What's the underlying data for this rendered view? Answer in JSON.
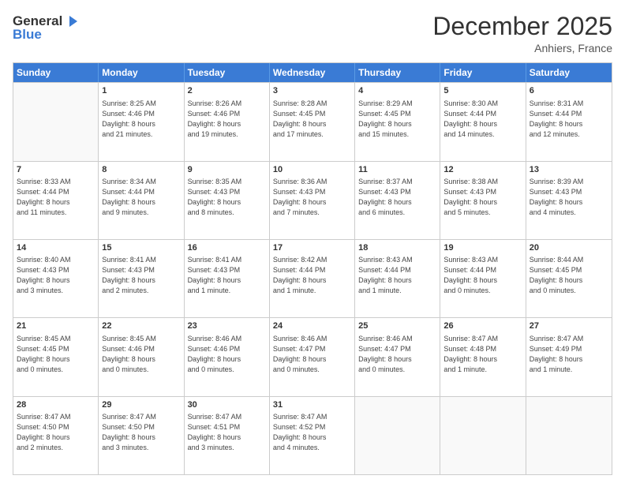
{
  "header": {
    "logo_general": "General",
    "logo_blue": "Blue",
    "month_title": "December 2025",
    "location": "Anhiers, France"
  },
  "day_headers": [
    "Sunday",
    "Monday",
    "Tuesday",
    "Wednesday",
    "Thursday",
    "Friday",
    "Saturday"
  ],
  "weeks": [
    [
      {
        "date": "",
        "info": ""
      },
      {
        "date": "1",
        "info": "Sunrise: 8:25 AM\nSunset: 4:46 PM\nDaylight: 8 hours\nand 21 minutes."
      },
      {
        "date": "2",
        "info": "Sunrise: 8:26 AM\nSunset: 4:46 PM\nDaylight: 8 hours\nand 19 minutes."
      },
      {
        "date": "3",
        "info": "Sunrise: 8:28 AM\nSunset: 4:45 PM\nDaylight: 8 hours\nand 17 minutes."
      },
      {
        "date": "4",
        "info": "Sunrise: 8:29 AM\nSunset: 4:45 PM\nDaylight: 8 hours\nand 15 minutes."
      },
      {
        "date": "5",
        "info": "Sunrise: 8:30 AM\nSunset: 4:44 PM\nDaylight: 8 hours\nand 14 minutes."
      },
      {
        "date": "6",
        "info": "Sunrise: 8:31 AM\nSunset: 4:44 PM\nDaylight: 8 hours\nand 12 minutes."
      }
    ],
    [
      {
        "date": "7",
        "info": "Sunrise: 8:33 AM\nSunset: 4:44 PM\nDaylight: 8 hours\nand 11 minutes."
      },
      {
        "date": "8",
        "info": "Sunrise: 8:34 AM\nSunset: 4:44 PM\nDaylight: 8 hours\nand 9 minutes."
      },
      {
        "date": "9",
        "info": "Sunrise: 8:35 AM\nSunset: 4:43 PM\nDaylight: 8 hours\nand 8 minutes."
      },
      {
        "date": "10",
        "info": "Sunrise: 8:36 AM\nSunset: 4:43 PM\nDaylight: 8 hours\nand 7 minutes."
      },
      {
        "date": "11",
        "info": "Sunrise: 8:37 AM\nSunset: 4:43 PM\nDaylight: 8 hours\nand 6 minutes."
      },
      {
        "date": "12",
        "info": "Sunrise: 8:38 AM\nSunset: 4:43 PM\nDaylight: 8 hours\nand 5 minutes."
      },
      {
        "date": "13",
        "info": "Sunrise: 8:39 AM\nSunset: 4:43 PM\nDaylight: 8 hours\nand 4 minutes."
      }
    ],
    [
      {
        "date": "14",
        "info": "Sunrise: 8:40 AM\nSunset: 4:43 PM\nDaylight: 8 hours\nand 3 minutes."
      },
      {
        "date": "15",
        "info": "Sunrise: 8:41 AM\nSunset: 4:43 PM\nDaylight: 8 hours\nand 2 minutes."
      },
      {
        "date": "16",
        "info": "Sunrise: 8:41 AM\nSunset: 4:43 PM\nDaylight: 8 hours\nand 1 minute."
      },
      {
        "date": "17",
        "info": "Sunrise: 8:42 AM\nSunset: 4:44 PM\nDaylight: 8 hours\nand 1 minute."
      },
      {
        "date": "18",
        "info": "Sunrise: 8:43 AM\nSunset: 4:44 PM\nDaylight: 8 hours\nand 1 minute."
      },
      {
        "date": "19",
        "info": "Sunrise: 8:43 AM\nSunset: 4:44 PM\nDaylight: 8 hours\nand 0 minutes."
      },
      {
        "date": "20",
        "info": "Sunrise: 8:44 AM\nSunset: 4:45 PM\nDaylight: 8 hours\nand 0 minutes."
      }
    ],
    [
      {
        "date": "21",
        "info": "Sunrise: 8:45 AM\nSunset: 4:45 PM\nDaylight: 8 hours\nand 0 minutes."
      },
      {
        "date": "22",
        "info": "Sunrise: 8:45 AM\nSunset: 4:46 PM\nDaylight: 8 hours\nand 0 minutes."
      },
      {
        "date": "23",
        "info": "Sunrise: 8:46 AM\nSunset: 4:46 PM\nDaylight: 8 hours\nand 0 minutes."
      },
      {
        "date": "24",
        "info": "Sunrise: 8:46 AM\nSunset: 4:47 PM\nDaylight: 8 hours\nand 0 minutes."
      },
      {
        "date": "25",
        "info": "Sunrise: 8:46 AM\nSunset: 4:47 PM\nDaylight: 8 hours\nand 0 minutes."
      },
      {
        "date": "26",
        "info": "Sunrise: 8:47 AM\nSunset: 4:48 PM\nDaylight: 8 hours\nand 1 minute."
      },
      {
        "date": "27",
        "info": "Sunrise: 8:47 AM\nSunset: 4:49 PM\nDaylight: 8 hours\nand 1 minute."
      }
    ],
    [
      {
        "date": "28",
        "info": "Sunrise: 8:47 AM\nSunset: 4:50 PM\nDaylight: 8 hours\nand 2 minutes."
      },
      {
        "date": "29",
        "info": "Sunrise: 8:47 AM\nSunset: 4:50 PM\nDaylight: 8 hours\nand 3 minutes."
      },
      {
        "date": "30",
        "info": "Sunrise: 8:47 AM\nSunset: 4:51 PM\nDaylight: 8 hours\nand 3 minutes."
      },
      {
        "date": "31",
        "info": "Sunrise: 8:47 AM\nSunset: 4:52 PM\nDaylight: 8 hours\nand 4 minutes."
      },
      {
        "date": "",
        "info": ""
      },
      {
        "date": "",
        "info": ""
      },
      {
        "date": "",
        "info": ""
      }
    ]
  ]
}
